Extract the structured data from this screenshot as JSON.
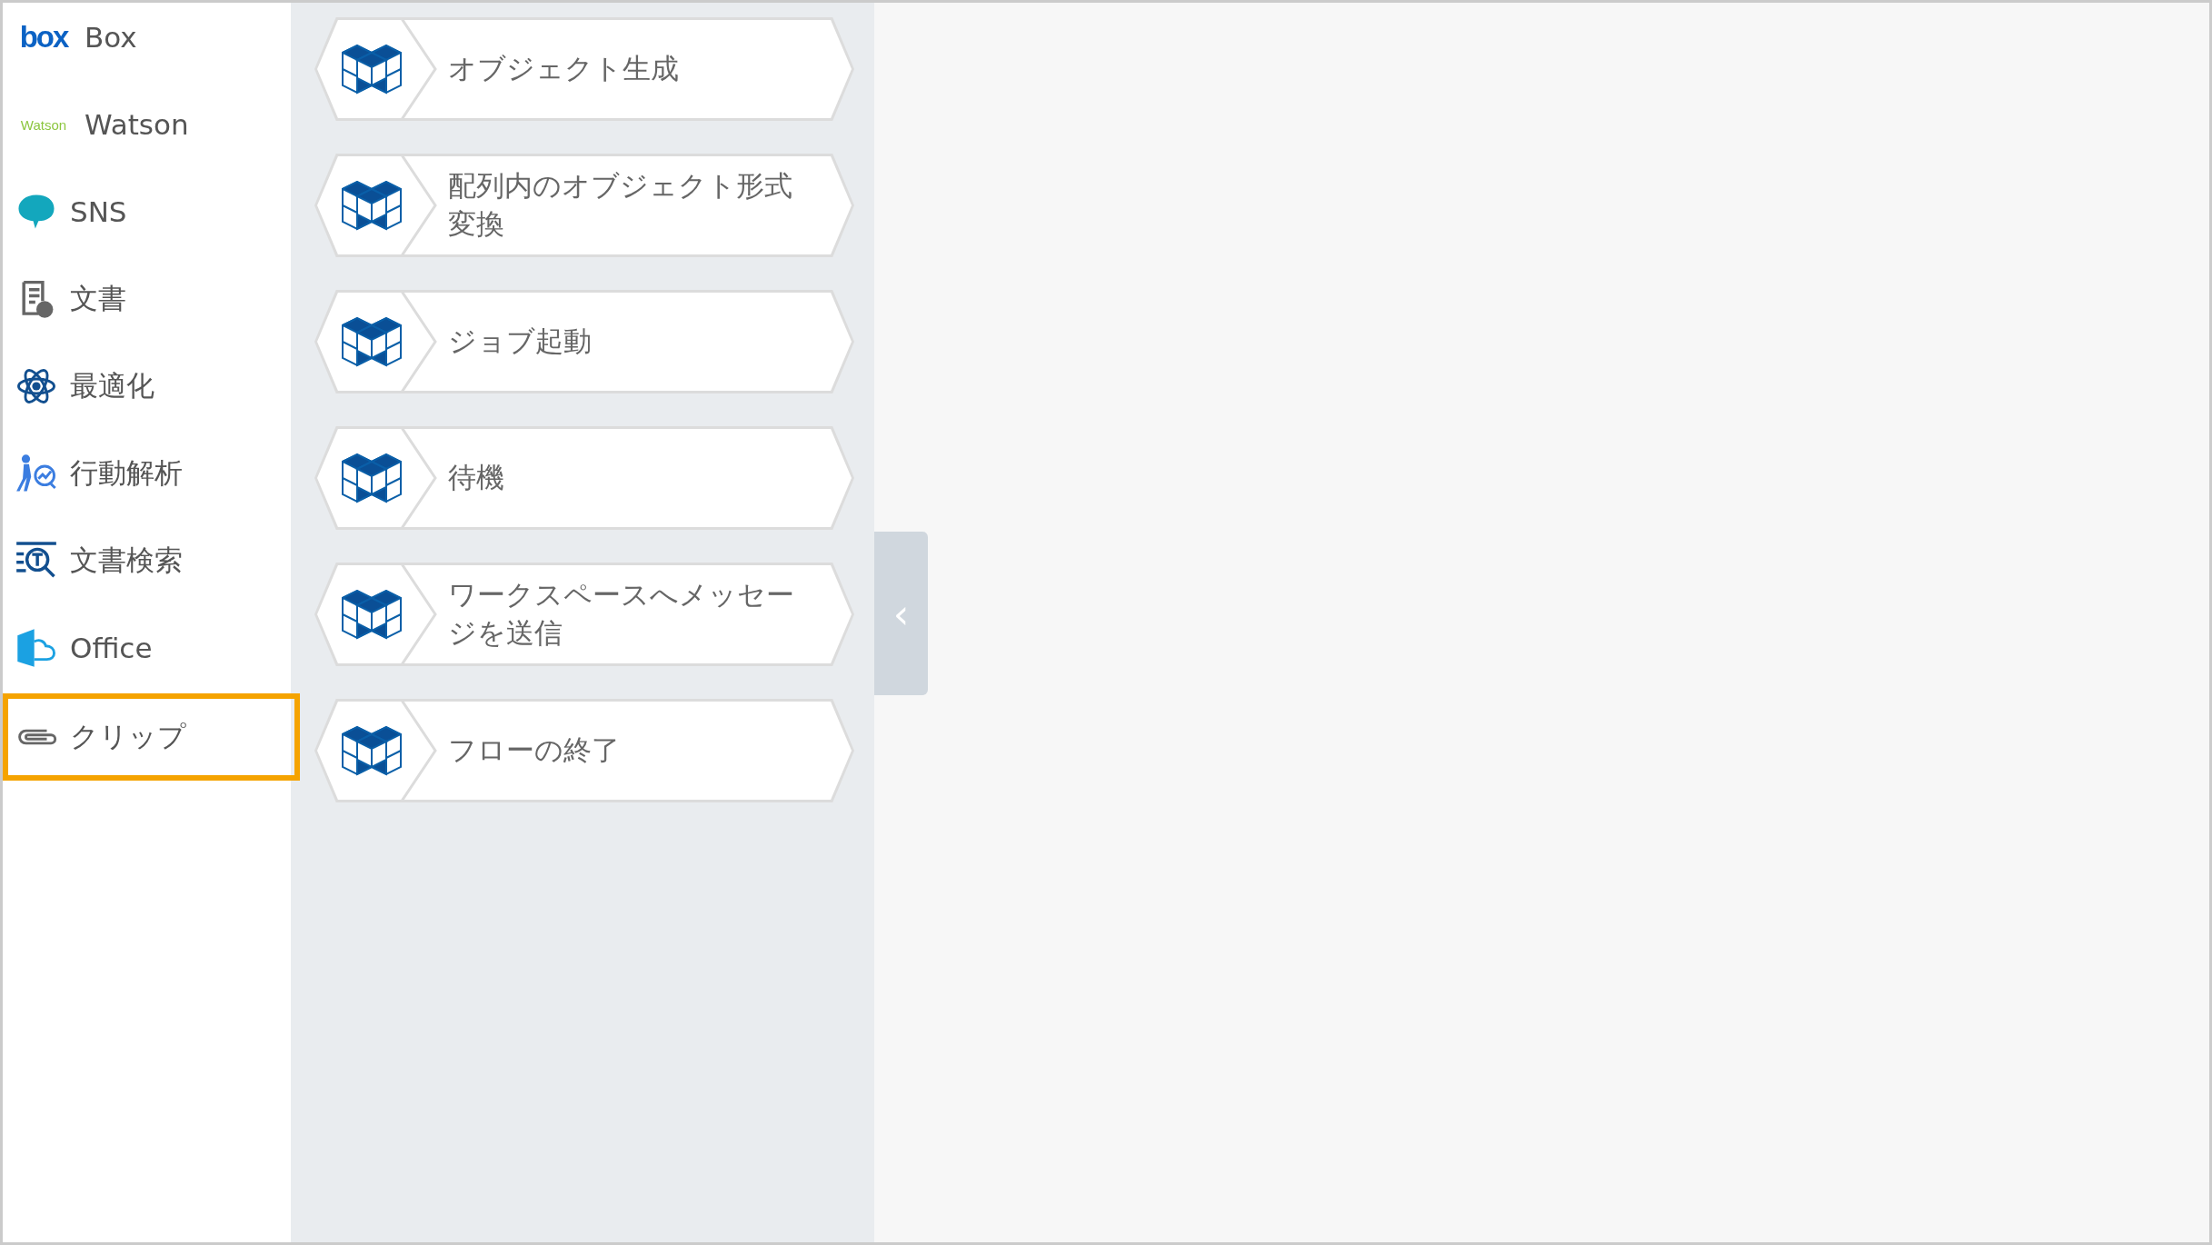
{
  "sidebar": {
    "items": [
      {
        "kind": "box",
        "logo": "box",
        "label": "Box",
        "selected": false
      },
      {
        "kind": "watson",
        "logo": "Watson",
        "label": "Watson",
        "selected": false
      },
      {
        "kind": "sns",
        "label": "SNS",
        "selected": false
      },
      {
        "kind": "document",
        "label": "文書",
        "selected": false
      },
      {
        "kind": "optimize",
        "label": "最適化",
        "selected": false
      },
      {
        "kind": "behavior",
        "label": "行動解析",
        "selected": false
      },
      {
        "kind": "doc-search",
        "label": "文書検索",
        "selected": false
      },
      {
        "kind": "office",
        "label": "Office",
        "selected": false
      },
      {
        "kind": "clip",
        "label": "クリップ",
        "selected": true
      }
    ]
  },
  "blocks": [
    {
      "label": "オブジェクト生成"
    },
    {
      "label": "配列内のオブジェクト形式変換"
    },
    {
      "label": "ジョブ起動"
    },
    {
      "label": "待機"
    },
    {
      "label": "ワークスペースへメッセージを送信"
    },
    {
      "label": "フローの終了"
    }
  ],
  "collapse_tab": {
    "glyph": "‹"
  }
}
